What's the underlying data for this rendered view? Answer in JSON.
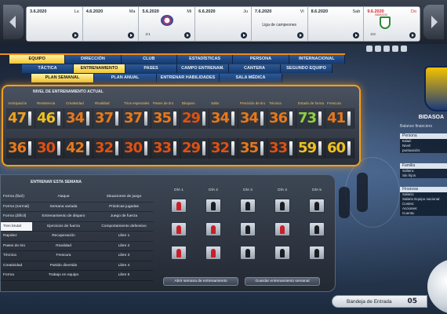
{
  "calendar": {
    "days": [
      {
        "date": "3.6.2020",
        "dow": "Lu",
        "event": "",
        "sub": "",
        "today": false
      },
      {
        "date": "4.6.2020",
        "dow": "Ma",
        "event": "",
        "sub": "",
        "today": false
      },
      {
        "date": "5.6.2020",
        "dow": "Mi",
        "event": "",
        "sub": "3:1",
        "today": false
      },
      {
        "date": "6.6.2020",
        "dow": "Ju",
        "event": "",
        "sub": "",
        "today": false
      },
      {
        "date": "7.6.2020",
        "dow": "Vi",
        "event": "Liga de campeones",
        "sub": "",
        "today": false
      },
      {
        "date": "8.6.2020",
        "dow": "Sab",
        "event": "",
        "sub": "",
        "today": false
      },
      {
        "date": "9.6.2020",
        "dow": "Do",
        "event": "",
        "sub": "3:0",
        "today": true
      }
    ],
    "badge_text": "BIDASOA"
  },
  "nav": {
    "row1": [
      "Equipo",
      "Dirección",
      "Club",
      "Estadísticas",
      "Persona",
      "Internacional"
    ],
    "row2": [
      "Táctica",
      "Entrenamiento",
      "Pases",
      "Campo entrenam.",
      "Cantera",
      "Segundo equipo"
    ],
    "row3": [
      "Plan semanal",
      "Plan anual",
      "Entrenar habilidades",
      "Sala médica"
    ]
  },
  "level": {
    "title": "NIVEL DE ENTRENAMIENTO ACTUAL",
    "attributes": [
      "Anticipación",
      "Resistencia",
      "Creatividad",
      "Rivalidad",
      "Tiros especiales",
      "Pases de tiro",
      "Bloqueo",
      "Salto",
      "Precisión de tiro",
      "Técnica",
      "Estado de forma",
      "Frescura"
    ],
    "row1": [
      {
        "v": "47",
        "c": "#f0a020"
      },
      {
        "v": "46",
        "c": "#f0c020"
      },
      {
        "v": "34",
        "c": "#e8781a"
      },
      {
        "v": "37",
        "c": "#e8781a"
      },
      {
        "v": "37",
        "c": "#e8781a"
      },
      {
        "v": "35",
        "c": "#e8781a"
      },
      {
        "v": "29",
        "c": "#e05010"
      },
      {
        "v": "34",
        "c": "#e8781a"
      },
      {
        "v": "34",
        "c": "#e8781a"
      },
      {
        "v": "36",
        "c": "#e8781a"
      },
      {
        "v": "73",
        "c": "#8fd040"
      },
      {
        "v": "41",
        "c": "#e8781a"
      }
    ],
    "row2": [
      {
        "v": "36",
        "c": "#e8781a"
      },
      {
        "v": "30",
        "c": "#e05010"
      },
      {
        "v": "42",
        "c": "#e8781a"
      },
      {
        "v": "32",
        "c": "#e05010"
      },
      {
        "v": "30",
        "c": "#e05010"
      },
      {
        "v": "33",
        "c": "#e05010"
      },
      {
        "v": "29",
        "c": "#e05010"
      },
      {
        "v": "32",
        "c": "#e05010"
      },
      {
        "v": "35",
        "c": "#e8781a"
      },
      {
        "v": "33",
        "c": "#e05010"
      },
      {
        "v": "59",
        "c": "#f0c020"
      },
      {
        "v": "60",
        "c": "#f0c020"
      }
    ]
  },
  "week": {
    "title": "ENTRENAR ESTA SEMANA",
    "col1": [
      "Forma (fácil)",
      "Forma (normal)",
      "Forma (difícil)",
      "Tren brutal",
      "Rapidez",
      "Pases de tiro",
      "Técnica",
      "Creatividad",
      "Forma"
    ],
    "col2": [
      "Ataque",
      "Semana variada",
      "Entrenamiento de disparo",
      "Ejercicios de fuerza",
      "Recuperación",
      "Rivalidad",
      "Frescura",
      "Partido divertido",
      "Trabajo en equipo"
    ],
    "col3": [
      "Situaciones de juego",
      "Prácticas jugadas",
      "Juego de fuerza",
      "Comportamiento defensivo",
      "Libre 1",
      "Libre 2",
      "Libre 3",
      "Libre 4",
      "Libre 5"
    ],
    "days": [
      "DÍA 1",
      "DÍA 2",
      "DÍA 3",
      "DÍA 4",
      "DÍA 5"
    ],
    "drills": [
      [
        "red",
        "red",
        "red"
      ],
      [
        "black",
        "red",
        "red"
      ],
      [
        "black",
        "black",
        "black"
      ],
      [
        "black",
        "red",
        "black"
      ],
      [
        "black",
        "black",
        "black"
      ]
    ],
    "btn_open": "Abrir semana de entrenamiento",
    "btn_save": "Guardar entrenamiento semanal"
  },
  "sidebar": {
    "club_name": "BIDASOA",
    "balance_label": "Balance financiero",
    "persona_head": "Persona",
    "persona_lines": [
      "Edad:",
      "Nivel:",
      "puntuación:"
    ],
    "familia_head": "Familia",
    "familia_lines": [
      "Soltero:",
      "Sin hijos"
    ],
    "finanzas_head": "Finanzas",
    "finanzas_lines": [
      "Salario:",
      "Salario Equipo nacional:",
      "Costes:",
      "Acciones:",
      "Cuenta:"
    ]
  },
  "inbox": {
    "label": "Bandeja de Entrada",
    "count": "05"
  }
}
